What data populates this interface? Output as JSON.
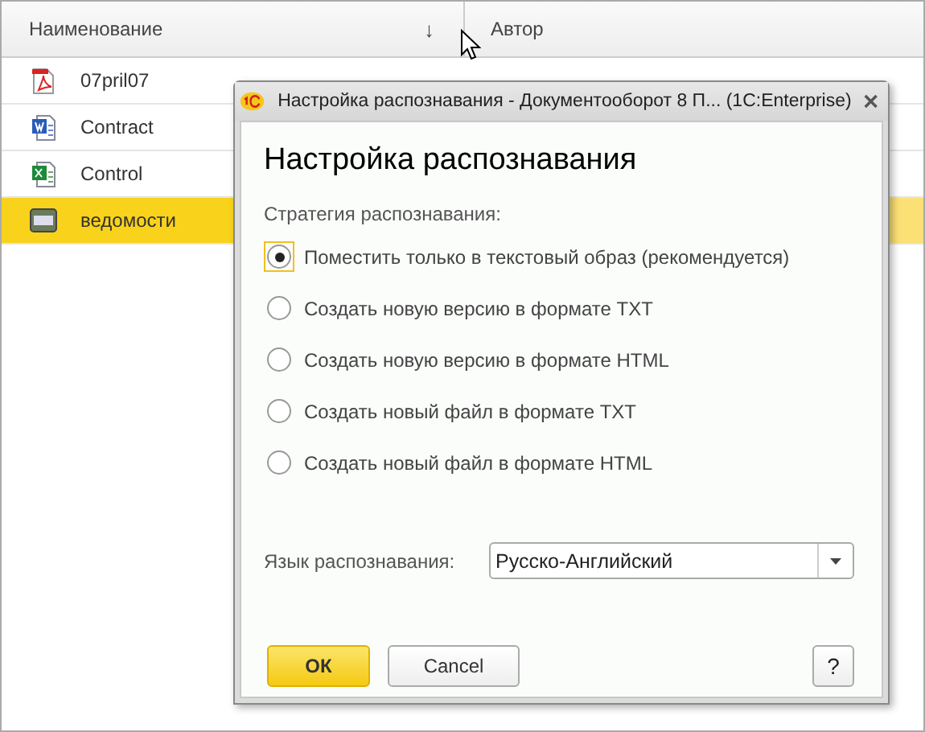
{
  "table": {
    "columns": [
      {
        "label": "Наименование",
        "sort": "↓"
      },
      {
        "label": "Автор"
      }
    ],
    "rows": [
      {
        "kind": "pdf",
        "name": "07pril07",
        "selected": false
      },
      {
        "kind": "word",
        "name": "Contract",
        "selected": false
      },
      {
        "kind": "excel",
        "name": "Control",
        "selected": false
      },
      {
        "kind": "jpg",
        "name": "ведомости",
        "selected": true
      }
    ]
  },
  "dialog": {
    "title": "Настройка распознавания - Документооборот 8 П...  (1C:Enterprise)",
    "heading": "Настройка распознавания",
    "strategy_label": "Стратегия распознавания:",
    "options": [
      {
        "label": "Поместить только в текстовый образ (рекомендуется)",
        "selected": true
      },
      {
        "label": "Создать новую версию в формате TXT",
        "selected": false
      },
      {
        "label": "Создать новую версию в формате HTML",
        "selected": false
      },
      {
        "label": "Создать новый файл в формате TXT",
        "selected": false
      },
      {
        "label": "Создать новый файл в формате HTML",
        "selected": false
      }
    ],
    "language": {
      "label": "Язык распознавания:",
      "value": "Русско-Английский"
    },
    "buttons": {
      "ok": "ОК",
      "cancel": "Cancel",
      "help": "?"
    }
  }
}
